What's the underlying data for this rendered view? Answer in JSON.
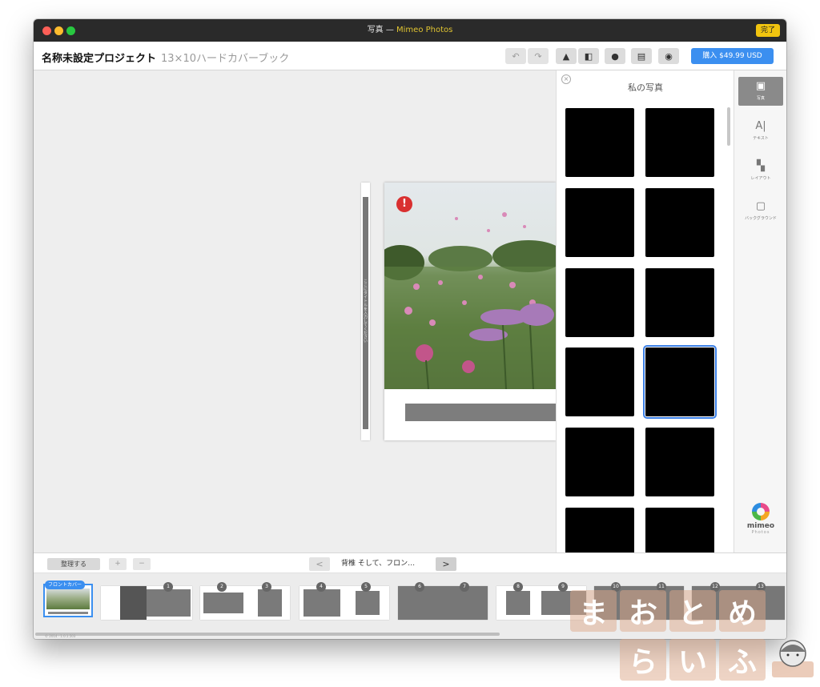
{
  "window": {
    "title": "写真",
    "title_app": "Mimeo Photos",
    "done_label": "完了"
  },
  "toolbar": {
    "project_title": "名称未設定プロジェクト",
    "project_format": "13×10ハードカバーブック",
    "buy_label": "購入 $49.99 USD",
    "icons": [
      "undo-icon",
      "redo-icon",
      "stamp-icon",
      "book-icon",
      "info-icon",
      "comment-icon",
      "preview-eye-icon"
    ]
  },
  "canvas": {
    "spine_text": "ここにタイトルを入力してください",
    "warning_glyph": "!"
  },
  "panel": {
    "title": "私の写真",
    "close_glyph": "×",
    "selected_index": 7
  },
  "rail": {
    "items": [
      {
        "label": "写真",
        "icon": "photo-icon",
        "glyph": "▣"
      },
      {
        "label": "テキスト",
        "icon": "text-icon",
        "glyph": "A|"
      },
      {
        "label": "レイアウト",
        "icon": "layout-icon",
        "glyph": "▚"
      },
      {
        "label": "バックグラウンド",
        "icon": "background-icon",
        "glyph": "▢"
      }
    ],
    "brand": "mimeo",
    "brand_sub": "Photos"
  },
  "bottombar": {
    "arrange_label": "整理する",
    "page_label": "背椎 そして、フロン…",
    "prev_glyph": "<",
    "next_glyph": ">",
    "add_glyph": "+",
    "remove_glyph": "−"
  },
  "filmstrip": {
    "cover_tag": "フロントカバー",
    "pages": [
      "1",
      "2",
      "3",
      "4",
      "5",
      "6",
      "7",
      "8",
      "9",
      "10",
      "11",
      "12",
      "13"
    ],
    "footer": "© 2014 · 1.0.1.503"
  },
  "watermark": {
    "row1": [
      "ま",
      "お",
      "と",
      "め"
    ],
    "row2": [
      "ら",
      "い",
      "ふ"
    ]
  }
}
